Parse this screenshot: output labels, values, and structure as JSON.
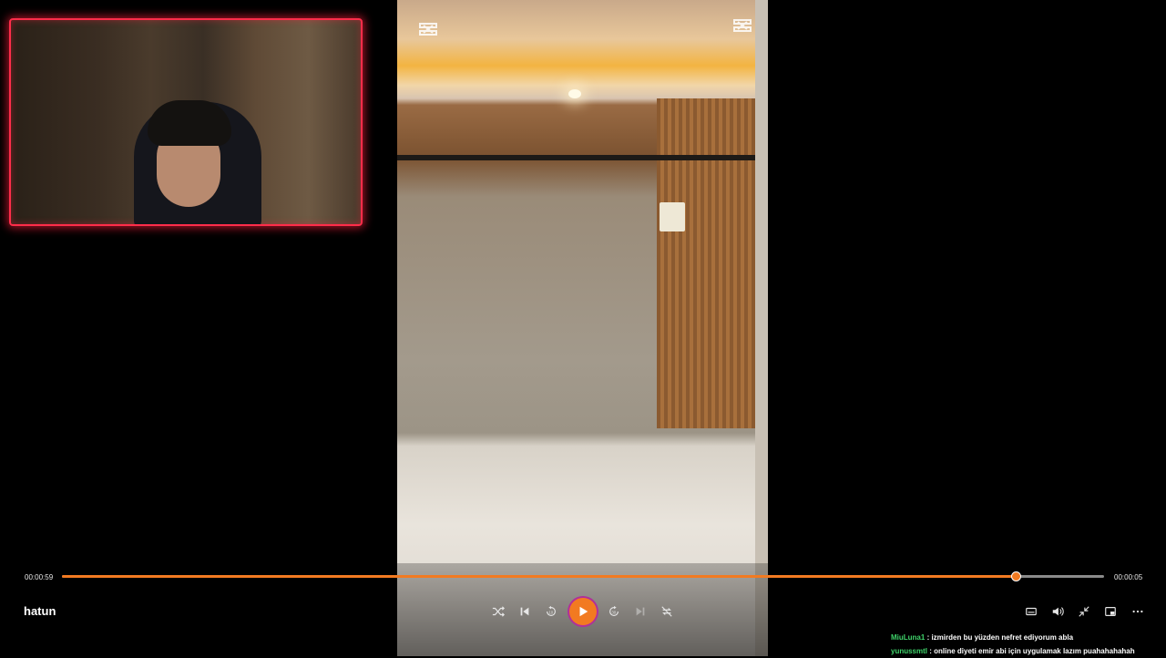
{
  "player": {
    "title": "hatun",
    "current_time": "00:00:59",
    "duration": "00:00:05",
    "progress_fraction": 0.915,
    "accent_color": "#f27a21"
  },
  "controls": {
    "left_group": [
      "shuffle-icon",
      "previous-icon",
      "rewind-10-icon",
      "play-icon",
      "forward-30-icon",
      "next-icon",
      "repeat-off-icon"
    ],
    "right_group": [
      "captions-icon",
      "volume-icon",
      "minimize-icon",
      "miniplayer-icon",
      "more-icon"
    ]
  },
  "watermark": {
    "icon": "capcut-logo-icon"
  },
  "chat": {
    "messages": [
      {
        "user": "MiuLuna1",
        "user_color": "#3fd36a",
        "text": " : izmirden bu yüzden nefret ediyorum abla"
      },
      {
        "user": "yunussmtl",
        "user_color": "#3fd36a",
        "text": " : online diyeti emir abi için uygulamak lazım puahahahahah"
      }
    ]
  },
  "webcam": {
    "border_color": "#ff2d4a"
  }
}
